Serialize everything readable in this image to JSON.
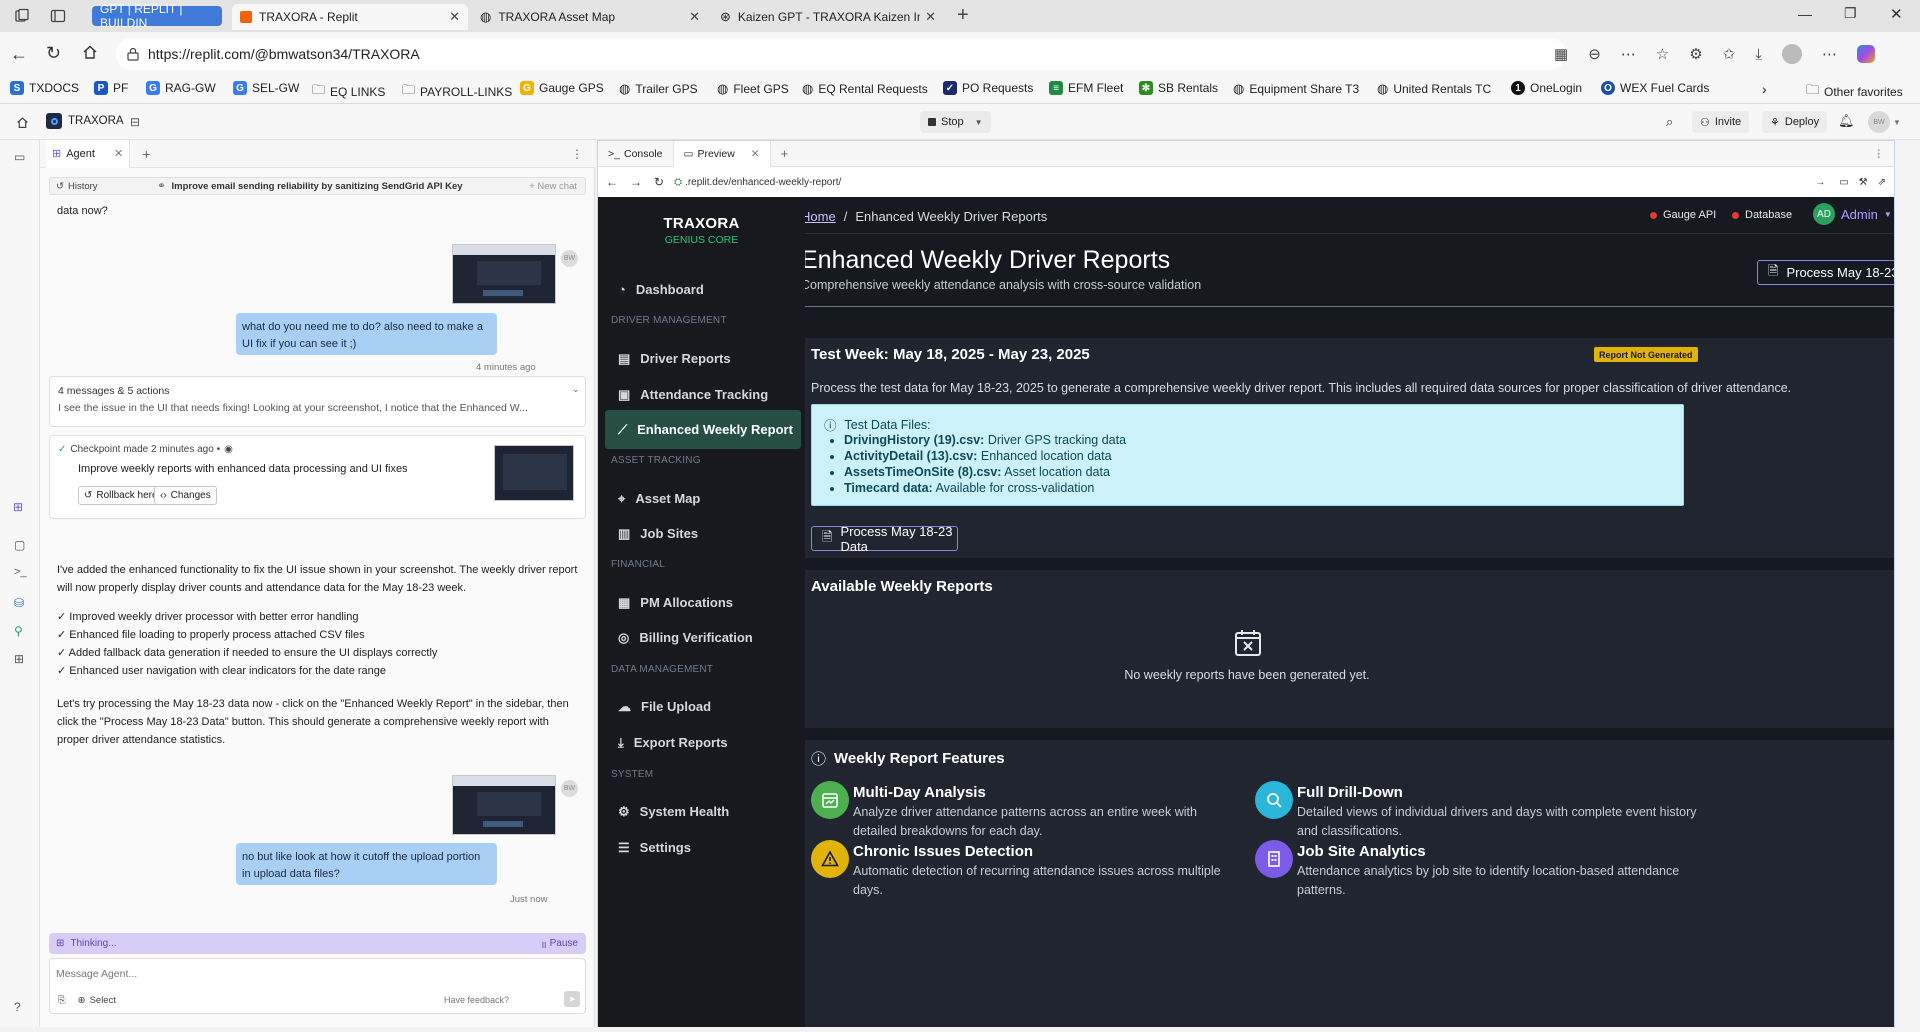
{
  "browser": {
    "tabs": [
      {
        "label": "GPT | REPLIT | BUILDIN",
        "active": false
      },
      {
        "label": "TRAXORA - Replit",
        "active": true
      },
      {
        "label": "TRAXORA Asset Map",
        "active": false
      },
      {
        "label": "Kaizen GPT - TRAXORA Kaizen Int",
        "active": false
      }
    ],
    "url": "https://replit.com/@bmwatson34/TRAXORA",
    "bookmarks": [
      "TXDOCS",
      "PF",
      "RAG-GW",
      "SEL-GW",
      "EQ LINKS",
      "PAYROLL-LINKS",
      "Gauge GPS",
      "Trailer GPS",
      "Fleet GPS",
      "EQ Rental Requests",
      "PO Requests",
      "EFM Fleet",
      "SB Rentals",
      "Equipment Share T3",
      "United Rentals TC",
      "OneLogin",
      "WEX Fuel Cards"
    ],
    "other_favorites": "Other favorites"
  },
  "replit": {
    "project": "TRAXORA",
    "stop_label": "Stop",
    "invite_label": "Invite",
    "deploy_label": "Deploy",
    "avatar_initials": "BW"
  },
  "agent": {
    "tab_label": "Agent",
    "history_label": "History",
    "history_title": "Improve email sending reliability by sanitizing SendGrid API Key",
    "new_chat": "+ New chat",
    "msg_prev_tail": "data now?",
    "msg1": "what do you need me to do? also need to make a UI fix if you can see it ;)",
    "msg1_time": "4 minutes ago",
    "summary_title": "4 messages & 5 actions",
    "summary_text": "I see the issue in the UI that needs fixing! Looking at your screenshot, I notice that the Enhanced W...",
    "checkpoint_label": "Checkpoint made 2 minutes ago •",
    "checkpoint_desc": "Improve weekly reports with enhanced data processing and UI fixes",
    "rollback_label": "Rollback here",
    "changes_label": "Changes",
    "reply_p1": "I've added the enhanced functionality to fix the UI issue shown in your screenshot. The weekly driver report will now properly display driver counts and attendance data for the May 18-23 week.",
    "reply_list": [
      "✓ Improved weekly driver processor with better error handling",
      "✓ Enhanced file loading to properly process attached CSV files",
      "✓ Added fallback data generation if needed to ensure the UI displays correctly",
      "✓ Enhanced user navigation with clear indicators for the date range"
    ],
    "reply_p2": "Let's try processing the May 18-23 data now - click on the \"Enhanced Weekly Report\" in the sidebar, then click the \"Process May 18-23 Data\" button. This should generate a comprehensive weekly report with proper driver attendance statistics.",
    "msg2": "no but like look at how it cutoff the upload portion in upload data files?",
    "msg2_time": "Just now",
    "thinking_label": "Thinking...",
    "pause_label": "Pause",
    "input_placeholder": "Message Agent...",
    "select_label": "Select",
    "feedback_label": "Have feedback?"
  },
  "preview": {
    "console_tab": "Console",
    "preview_tab": "Preview",
    "url": ".replit.dev/enhanced-weekly-report/"
  },
  "app": {
    "brand": "TRAXORA",
    "brand_sub": "GENIUS CORE",
    "breadcrumb_home": "Home",
    "breadcrumb_sep": "/",
    "breadcrumb_current": "Enhanced Weekly Driver Reports",
    "status_gauge": "Gauge API",
    "status_db": "Database",
    "admin_initials": "AD",
    "admin_label": "Admin",
    "page_title": "Enhanced Weekly Driver Reports",
    "page_subtitle": "Comprehensive weekly attendance analysis with cross-source validation",
    "process_btn": "Process May 18-23 Data",
    "nav": {
      "dashboard": "Dashboard",
      "sec_driver": "DRIVER MANAGEMENT",
      "driver_reports": "Driver Reports",
      "attendance": "Attendance Tracking",
      "enhanced": "Enhanced Weekly Report",
      "sec_asset": "ASSET TRACKING",
      "asset_map": "Asset Map",
      "job_sites": "Job Sites",
      "sec_financial": "FINANCIAL",
      "pm_alloc": "PM Allocations",
      "billing": "Billing Verification",
      "sec_data": "DATA MANAGEMENT",
      "file_upload": "File Upload",
      "export": "Export Reports",
      "sec_system": "SYSTEM",
      "health": "System Health",
      "settings": "Settings"
    },
    "test_week_title": "Test Week: May 18, 2025 - May 23, 2025",
    "report_badge": "Report Not Generated",
    "test_week_desc": "Process the test data for May 18-23, 2025 to generate a comprehensive weekly driver report. This includes all required data sources for proper classification of driver attendance.",
    "files_title": "Test Data Files:",
    "files": [
      {
        "name": "DrivingHistory (19).csv:",
        "desc": "Driver GPS tracking data"
      },
      {
        "name": "ActivityDetail (13).csv:",
        "desc": "Enhanced location data"
      },
      {
        "name": "AssetsTimeOnSite (8).csv:",
        "desc": "Asset location data"
      },
      {
        "name": "Timecard data:",
        "desc": "Available for cross-validation"
      }
    ],
    "available_title": "Available Weekly Reports",
    "empty_text": "No weekly reports have been generated yet.",
    "features_title": "Weekly Report Features",
    "features": [
      {
        "title": "Multi-Day Analysis",
        "desc": "Analyze driver attendance patterns across an entire week with detailed breakdowns for each day.",
        "color": "#4caf50"
      },
      {
        "title": "Full Drill-Down",
        "desc": "Detailed views of individual drivers and days with complete event history and classifications.",
        "color": "#29b6d8"
      },
      {
        "title": "Chronic Issues Detection",
        "desc": "Automatic detection of recurring attendance issues across multiple days.",
        "color": "#e0b30c"
      },
      {
        "title": "Job Site Analytics",
        "desc": "Attendance analytics by job site to identify location-based attendance patterns.",
        "color": "#7c5ce6"
      }
    ]
  }
}
